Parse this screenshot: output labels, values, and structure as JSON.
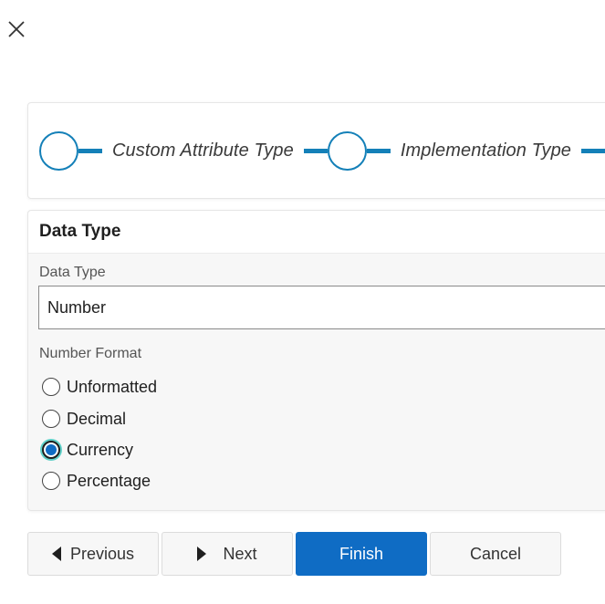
{
  "dialog": {
    "close_icon": "close-icon"
  },
  "stepper": {
    "steps": [
      {
        "label": "Custom Attribute Type"
      },
      {
        "label": "Implementation Type"
      }
    ],
    "accent": "#1480b8"
  },
  "panel": {
    "title": "Data Type",
    "data_type": {
      "label": "Data Type",
      "value": "Number"
    },
    "number_format": {
      "label": "Number Format",
      "options": [
        {
          "label": "Unformatted",
          "checked": false
        },
        {
          "label": "Decimal",
          "checked": false
        },
        {
          "label": "Currency",
          "checked": true
        },
        {
          "label": "Percentage",
          "checked": false
        }
      ]
    }
  },
  "buttons": {
    "previous": "Previous",
    "next": "Next",
    "finish": "Finish",
    "cancel": "Cancel",
    "primary_color": "#0f6cc4"
  }
}
